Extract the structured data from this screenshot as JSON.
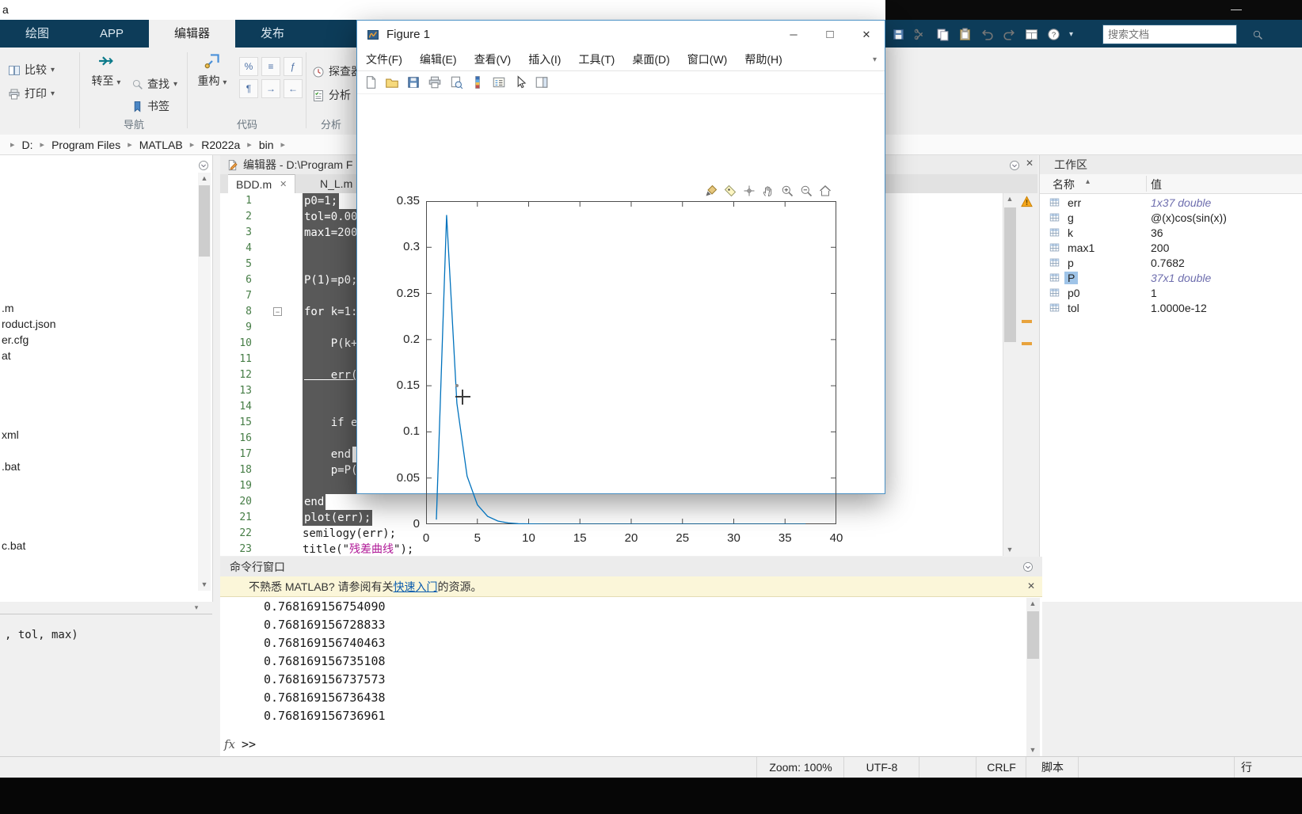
{
  "desktop": {
    "top_left_label": "a",
    "minimize_glyph": "—"
  },
  "ribbon": {
    "tabs": [
      {
        "key": "plots",
        "label": "绘图",
        "active": false
      },
      {
        "key": "apps",
        "label": "APP",
        "active": false
      },
      {
        "key": "editor",
        "label": "编辑器",
        "active": true
      },
      {
        "key": "publish",
        "label": "发布",
        "active": false
      }
    ],
    "compare_label": "比较",
    "print_label": "打印",
    "goto_label": "转至",
    "find_label": "查找",
    "bookmark_label": "书签",
    "nav_group_label": "导航",
    "refactor_label": "重构",
    "code_group_label": "代码",
    "profiler_label": "探查器",
    "analyze_label": "分析",
    "analyze_group_label": "分析",
    "quick_icons": [
      "save",
      "cut",
      "copy",
      "paste",
      "undo",
      "redo",
      "layout",
      "help",
      "more"
    ],
    "search_placeholder": "搜索文档"
  },
  "breadcrumb": {
    "items": [
      "D:",
      "Program Files",
      "MATLAB",
      "R2022a",
      "bin"
    ]
  },
  "file_panel": {
    "files": [
      ".m",
      "roduct.json",
      "er.cfg",
      "at",
      "xml",
      ".bat",
      "c.bat"
    ],
    "details_text": ", tol, max)"
  },
  "editor": {
    "title": "编辑器 - D:\\Program F",
    "tabs": [
      {
        "label": "BDD.m",
        "active": true,
        "close_glyph": "✕"
      },
      {
        "label": "N_L.m",
        "active": false
      }
    ],
    "lines": [
      {
        "n": 1,
        "text": "p0=1;",
        "sel": true
      },
      {
        "n": 2,
        "text": "tol=0.00",
        "sel": true
      },
      {
        "n": 3,
        "text": "max1=200",
        "sel": true
      },
      {
        "n": 4,
        "text": "",
        "sel": true
      },
      {
        "n": 5,
        "text": "",
        "sel": true
      },
      {
        "n": 6,
        "text": "P(1)=p0;",
        "sel": true
      },
      {
        "n": 7,
        "text": "",
        "sel": true
      },
      {
        "n": 8,
        "text": "for k=1:",
        "sel": true,
        "fold": true
      },
      {
        "n": 9,
        "text": "",
        "sel": true
      },
      {
        "n": 10,
        "text": "    P(k+",
        "sel": true
      },
      {
        "n": 11,
        "text": "",
        "sel": true
      },
      {
        "n": 12,
        "text": "    err(",
        "sel": true,
        "underline": true
      },
      {
        "n": 13,
        "text": "",
        "sel": true
      },
      {
        "n": 14,
        "text": "",
        "sel": true
      },
      {
        "n": 15,
        "text": "    if e",
        "sel": true
      },
      {
        "n": 16,
        "text": "",
        "sel": true
      },
      {
        "n": 17,
        "text": "    end",
        "sel": true
      },
      {
        "n": 18,
        "text": "    p=P(",
        "sel": true
      },
      {
        "n": 19,
        "text": "",
        "sel": true
      },
      {
        "n": 20,
        "text": "end",
        "sel": true
      },
      {
        "n": 21,
        "text": "plot(err);",
        "sel": true
      },
      {
        "n": 22,
        "text": "semilogy(err);",
        "sel": false
      },
      {
        "n": 23,
        "parts": [
          {
            "t": "title(\""
          },
          {
            "t": "残差曲线",
            "cls": "str"
          },
          {
            "t": "\");"
          }
        ],
        "sel": false
      }
    ]
  },
  "workspace": {
    "title": "工作区",
    "columns": {
      "name": "名称",
      "value": "值",
      "sort_glyph": "▴"
    },
    "rows": [
      {
        "name": "err",
        "value": "1x37 double",
        "dim": true
      },
      {
        "name": "g",
        "value": "@(x)cos(sin(x))"
      },
      {
        "name": "k",
        "value": "36"
      },
      {
        "name": "max1",
        "value": "200"
      },
      {
        "name": "p",
        "value": "0.7682"
      },
      {
        "name": "P",
        "value": "37x1 double",
        "dim": true,
        "selected": true
      },
      {
        "name": "p0",
        "value": "1"
      },
      {
        "name": "tol",
        "value": "1.0000e-12"
      }
    ]
  },
  "command_window": {
    "title": "命令行窗口",
    "banner": {
      "prefix": "不熟悉 MATLAB? 请参阅有关",
      "link": "快速入门",
      "suffix": "的资源。",
      "close_glyph": "✕"
    },
    "output": [
      "0.768169156754090",
      "0.768169156728833",
      "0.768169156740463",
      "0.768169156735108",
      "0.768169156737573",
      "0.768169156736438",
      "0.768169156736961"
    ],
    "fx_label": "fx",
    "prompt": ">>"
  },
  "figure_window": {
    "title": "Figure 1",
    "controls": {
      "minimize": "─",
      "maximize": "□",
      "close": "✕"
    },
    "menu": [
      {
        "key": "file",
        "label": "文件(F)"
      },
      {
        "key": "edit",
        "label": "编辑(E)"
      },
      {
        "key": "view",
        "label": "查看(V)"
      },
      {
        "key": "insert",
        "label": "插入(I)"
      },
      {
        "key": "tools",
        "label": "工具(T)"
      },
      {
        "key": "desktop",
        "label": "桌面(D)"
      },
      {
        "key": "window",
        "label": "窗口(W)"
      },
      {
        "key": "help",
        "label": "帮助(H)"
      }
    ],
    "toolbar_icons": [
      "new",
      "open",
      "save",
      "print",
      "preview",
      "colorbar",
      "legend",
      "edit-plot",
      "inspector"
    ],
    "axes_toolbar_icons": [
      "brush",
      "datatip",
      "select",
      "pan",
      "zoom-in",
      "zoom-out",
      "home"
    ]
  },
  "chart_data": {
    "type": "line",
    "title": "",
    "xlabel": "",
    "ylabel": "",
    "x": [
      1,
      2,
      3,
      4,
      5,
      6,
      7,
      8,
      9,
      10,
      11,
      12,
      13,
      14,
      15,
      16,
      17,
      18,
      19,
      20,
      21,
      22,
      23,
      24,
      25,
      26,
      27,
      28,
      29,
      30,
      31,
      32,
      33,
      34,
      35,
      36,
      37
    ],
    "y": [
      0.005,
      0.335,
      0.131,
      0.052,
      0.021,
      0.0085,
      0.0034,
      0.0014,
      0.00055,
      0.00022,
      8.8e-05,
      3.5e-05,
      1.4e-05,
      5.7e-06,
      2.3e-06,
      9.1e-07,
      3.6e-07,
      1.5e-07,
      5.8e-08,
      2.3e-08,
      9.3e-09,
      3.7e-09,
      1.5e-09,
      6e-10,
      2.4e-10,
      9.5e-11,
      3.8e-11,
      1.5e-11,
      6.1e-12,
      2.4e-12,
      9.7e-13,
      3.9e-13,
      1.6e-13,
      6.2e-14,
      2.5e-14,
      1e-14,
      4e-15
    ],
    "xlim": [
      0,
      40
    ],
    "ylim": [
      0,
      0.35
    ],
    "xticks": [
      0,
      5,
      10,
      15,
      20,
      25,
      30,
      35,
      40
    ],
    "xtick_labels": [
      "0",
      "5",
      "10",
      "15",
      "20",
      "25",
      "30",
      "35",
      "40"
    ],
    "yticks": [
      0,
      0.05,
      0.1,
      0.15,
      0.2,
      0.25,
      0.3,
      0.35
    ],
    "ytick_labels": [
      "0",
      "0.05",
      "0.1",
      "0.15",
      "0.2",
      "0.25",
      "0.3",
      "0.35"
    ],
    "line_color": "#0072BD",
    "grid": false,
    "legend": null
  },
  "status_bar": {
    "zoom": "Zoom: 100%",
    "encoding": "UTF-8",
    "line_ending": "CRLF",
    "file_type": "脚本",
    "line_label": "行"
  }
}
